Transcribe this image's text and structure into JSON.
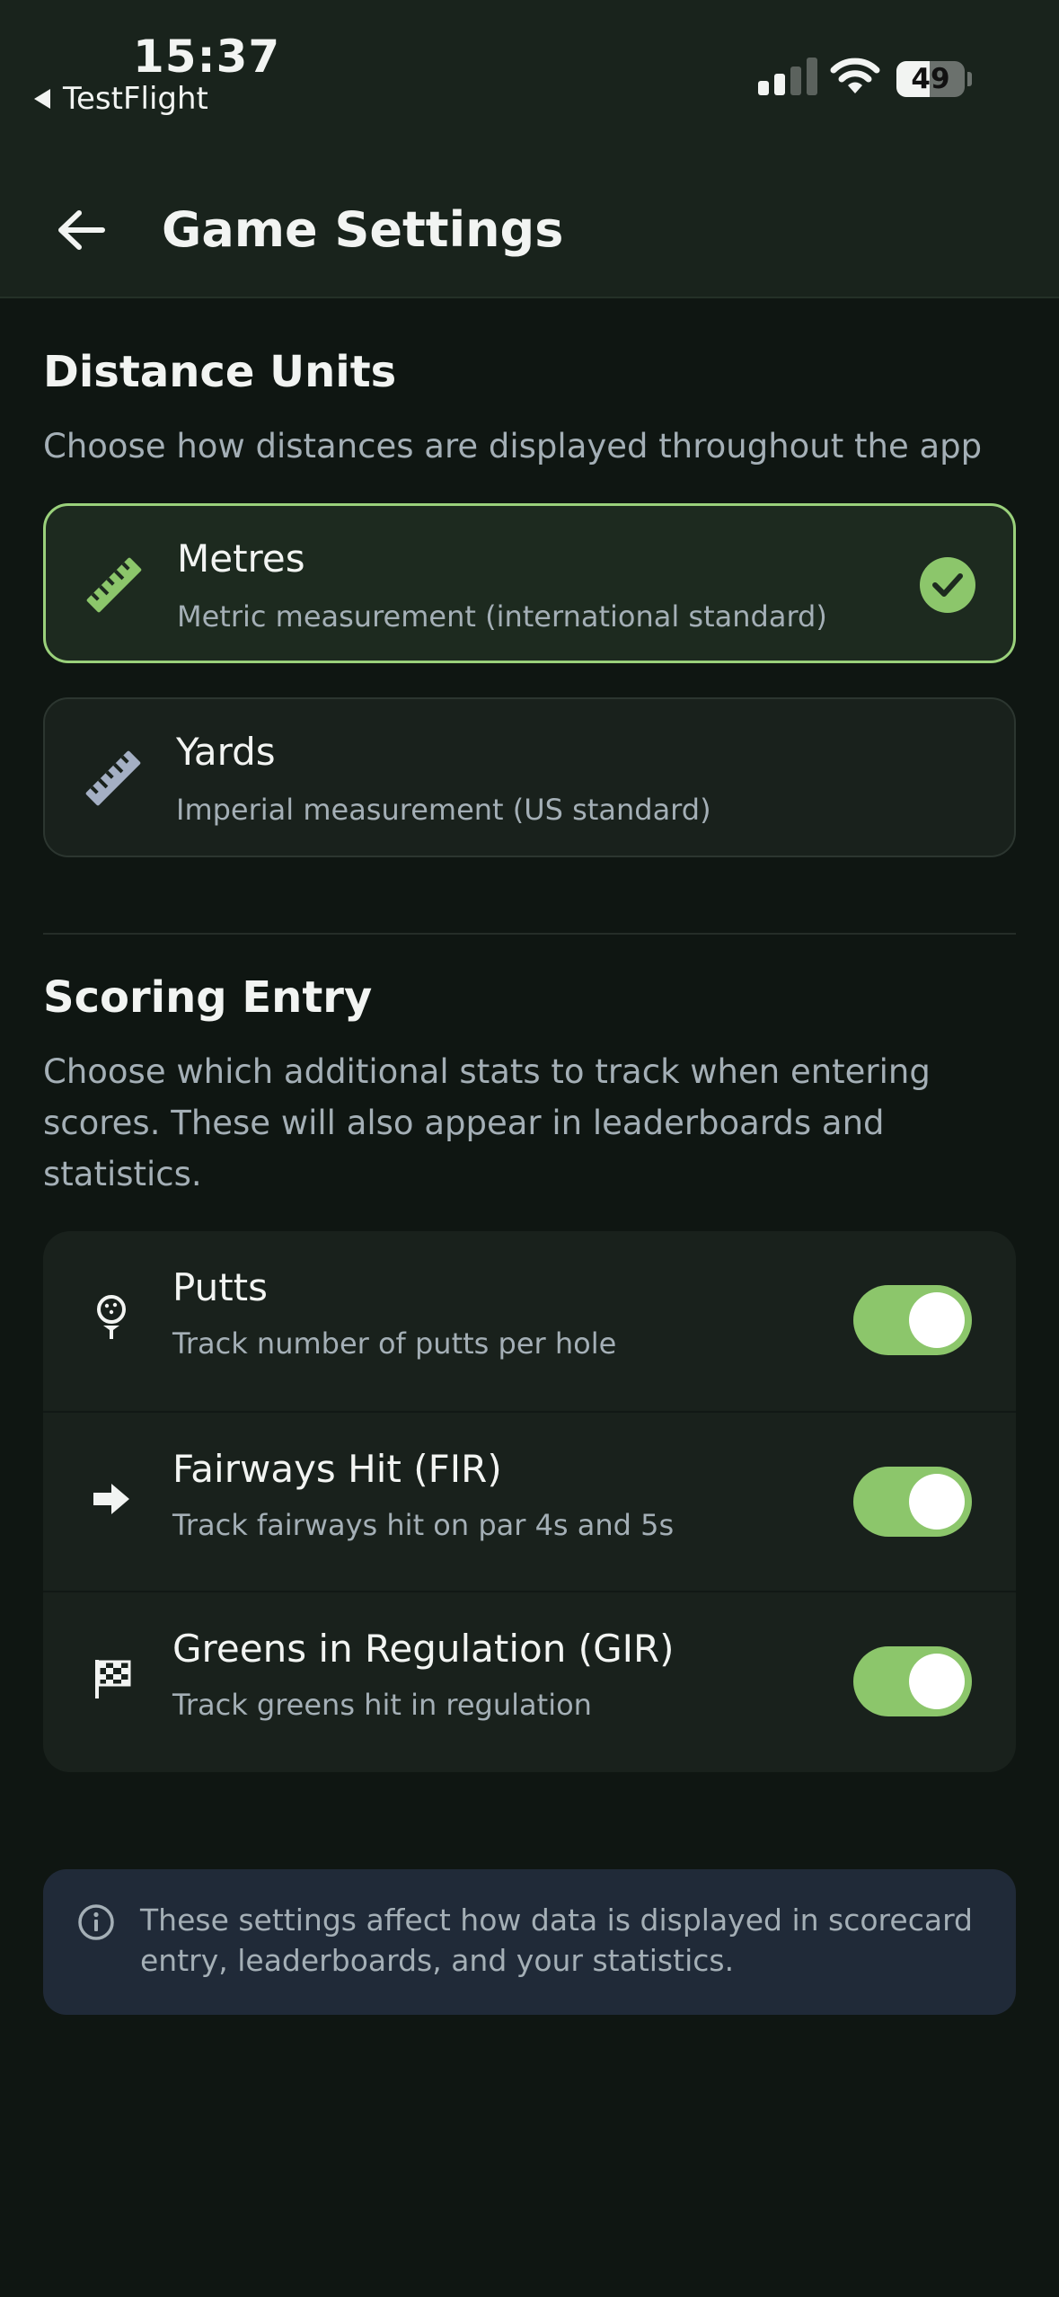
{
  "status_bar": {
    "time": "15:37",
    "back_app": "TestFlight",
    "battery": "49",
    "battery_level_percent": 49
  },
  "app_bar": {
    "title": "Game Settings"
  },
  "distance_units": {
    "heading": "Distance Units",
    "description": "Choose how distances are displayed throughout the app",
    "options": [
      {
        "name": "Metres",
        "description": "Metric measurement (international standard)",
        "selected": true,
        "icon": "ruler-icon"
      },
      {
        "name": "Yards",
        "description": "Imperial measurement (US standard)",
        "selected": false,
        "icon": "ruler-icon"
      }
    ]
  },
  "scoring_entry": {
    "heading": "Scoring Entry",
    "description": "Choose which additional stats to track when entering scores. These will also appear in leaderboards and statistics.",
    "items": [
      {
        "name": "Putts",
        "description": "Track number of putts per hole",
        "icon": "golf-ball-tee-icon",
        "enabled": true
      },
      {
        "name": "Fairways Hit (FIR)",
        "description": "Track fairways hit on par 4s and 5s",
        "icon": "arrow-right-icon",
        "enabled": true
      },
      {
        "name": "Greens in Regulation (GIR)",
        "description": "Track greens hit in regulation",
        "icon": "checkered-flag-icon",
        "enabled": true
      }
    ]
  },
  "info": {
    "text": "These settings affect how data is displayed in scorecard entry, leaderboards, and your statistics.",
    "icon": "info-icon"
  },
  "colors": {
    "accent_green": "#8cc66b",
    "background": "#0f1612",
    "header": "#19231c",
    "card": "#19211c",
    "info_box": "#202a38"
  }
}
